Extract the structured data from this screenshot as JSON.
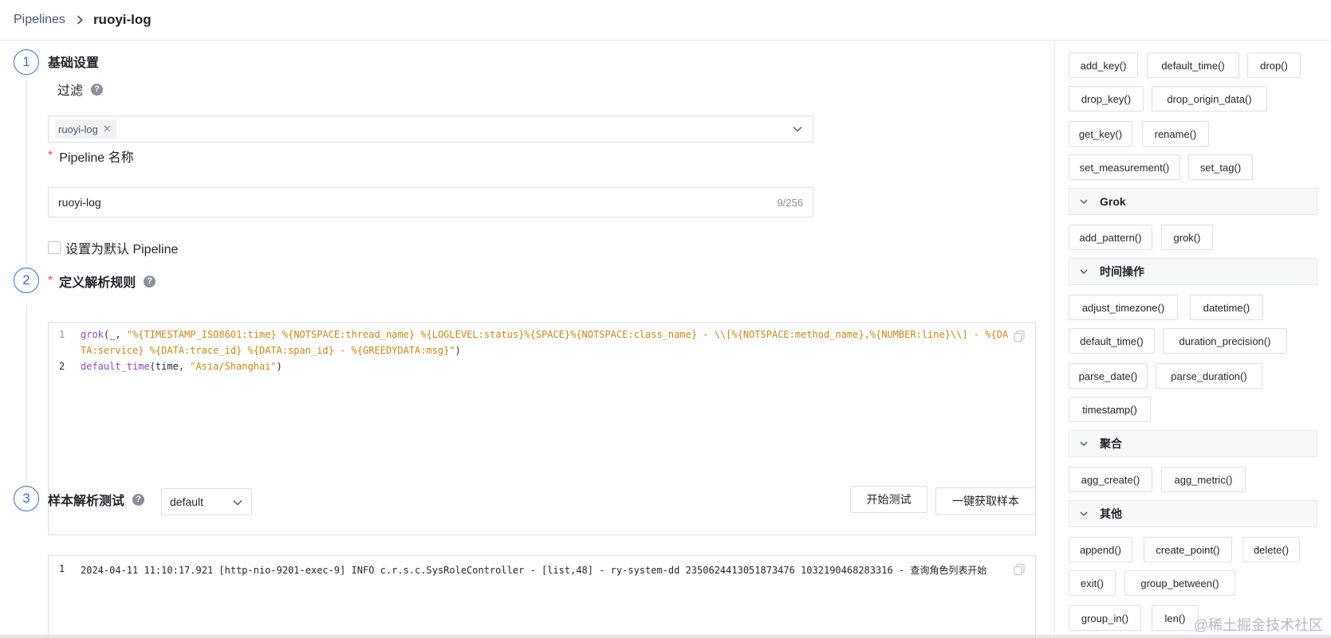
{
  "breadcrumb": {
    "root": "Pipelines",
    "current": "ruoyi-log"
  },
  "steps": [
    {
      "number": "1",
      "title": "基础设置"
    },
    {
      "number": "2",
      "title": "定义解析规则"
    },
    {
      "number": "3",
      "title": "样本解析测试"
    }
  ],
  "basic": {
    "filter_label": "过滤",
    "filter_tags": [
      "ruoyi-log"
    ],
    "name_label": "Pipeline 名称",
    "name_value": "ruoyi-log",
    "name_counter": "9/256",
    "default_checkbox_label": "设置为默认 Pipeline",
    "default_checked": false
  },
  "rules": {
    "lines": [
      {
        "number": "1",
        "fn": "grok",
        "pre": "(_, ",
        "str": "\"%{TIMESTAMP_ISO8601:time} %{NOTSPACE:thread_name} %{LOGLEVEL:status}%{SPACE}%{NOTSPACE:class_name} - \\\\[%{NOTSPACE:method_name},%{NUMBER:line}\\\\] - %{DA",
        "post": ""
      },
      {
        "number": "",
        "fn": "",
        "pre": "",
        "str": "TA:service} %{DATA:trace_id} %{DATA:span_id} - %{GREEDYDATA:msg}\"",
        "post": ")"
      },
      {
        "number": "2",
        "fn": "default_time",
        "pre": "(time, ",
        "str": "\"Asia/Shanghai\"",
        "post": ")"
      }
    ]
  },
  "sample": {
    "select_value": "default",
    "start_test_label": "开始测试",
    "fetch_sample_label": "一键获取样本",
    "line_number": "1",
    "line_text": "2024-04-11 11:10:17.921 [http-nio-9201-exec-9] INFO  c.r.s.c.SysRoleController - [list,48] - ry-system-dd 2350624413051873476 1032190468283316 - 查询角色列表开始"
  },
  "functions": {
    "top": [
      "add_key()",
      "default_time()",
      "drop()",
      "drop_key()",
      "drop_origin_data()",
      "get_key()",
      "rename()",
      "set_measurement()",
      "set_tag()"
    ],
    "groups": [
      {
        "name": "Grok",
        "items": [
          "add_pattern()",
          "grok()"
        ]
      },
      {
        "name": "时间操作",
        "items": [
          "adjust_timezone()",
          "datetime()",
          "default_time()",
          "duration_precision()",
          "parse_date()",
          "parse_duration()",
          "timestamp()"
        ]
      },
      {
        "name": "聚合",
        "items": [
          "agg_create()",
          "agg_metric()"
        ]
      },
      {
        "name": "其他",
        "items": [
          "append()",
          "create_point()",
          "delete()",
          "exit()",
          "group_between()",
          "group_in()",
          "len()"
        ]
      }
    ]
  },
  "watermark": "@稀土掘金技术社区",
  "colors": {
    "accent": "#3b6fd4",
    "required": "#e34d59",
    "function": "#8a4ab8",
    "string": "#c2891d"
  }
}
